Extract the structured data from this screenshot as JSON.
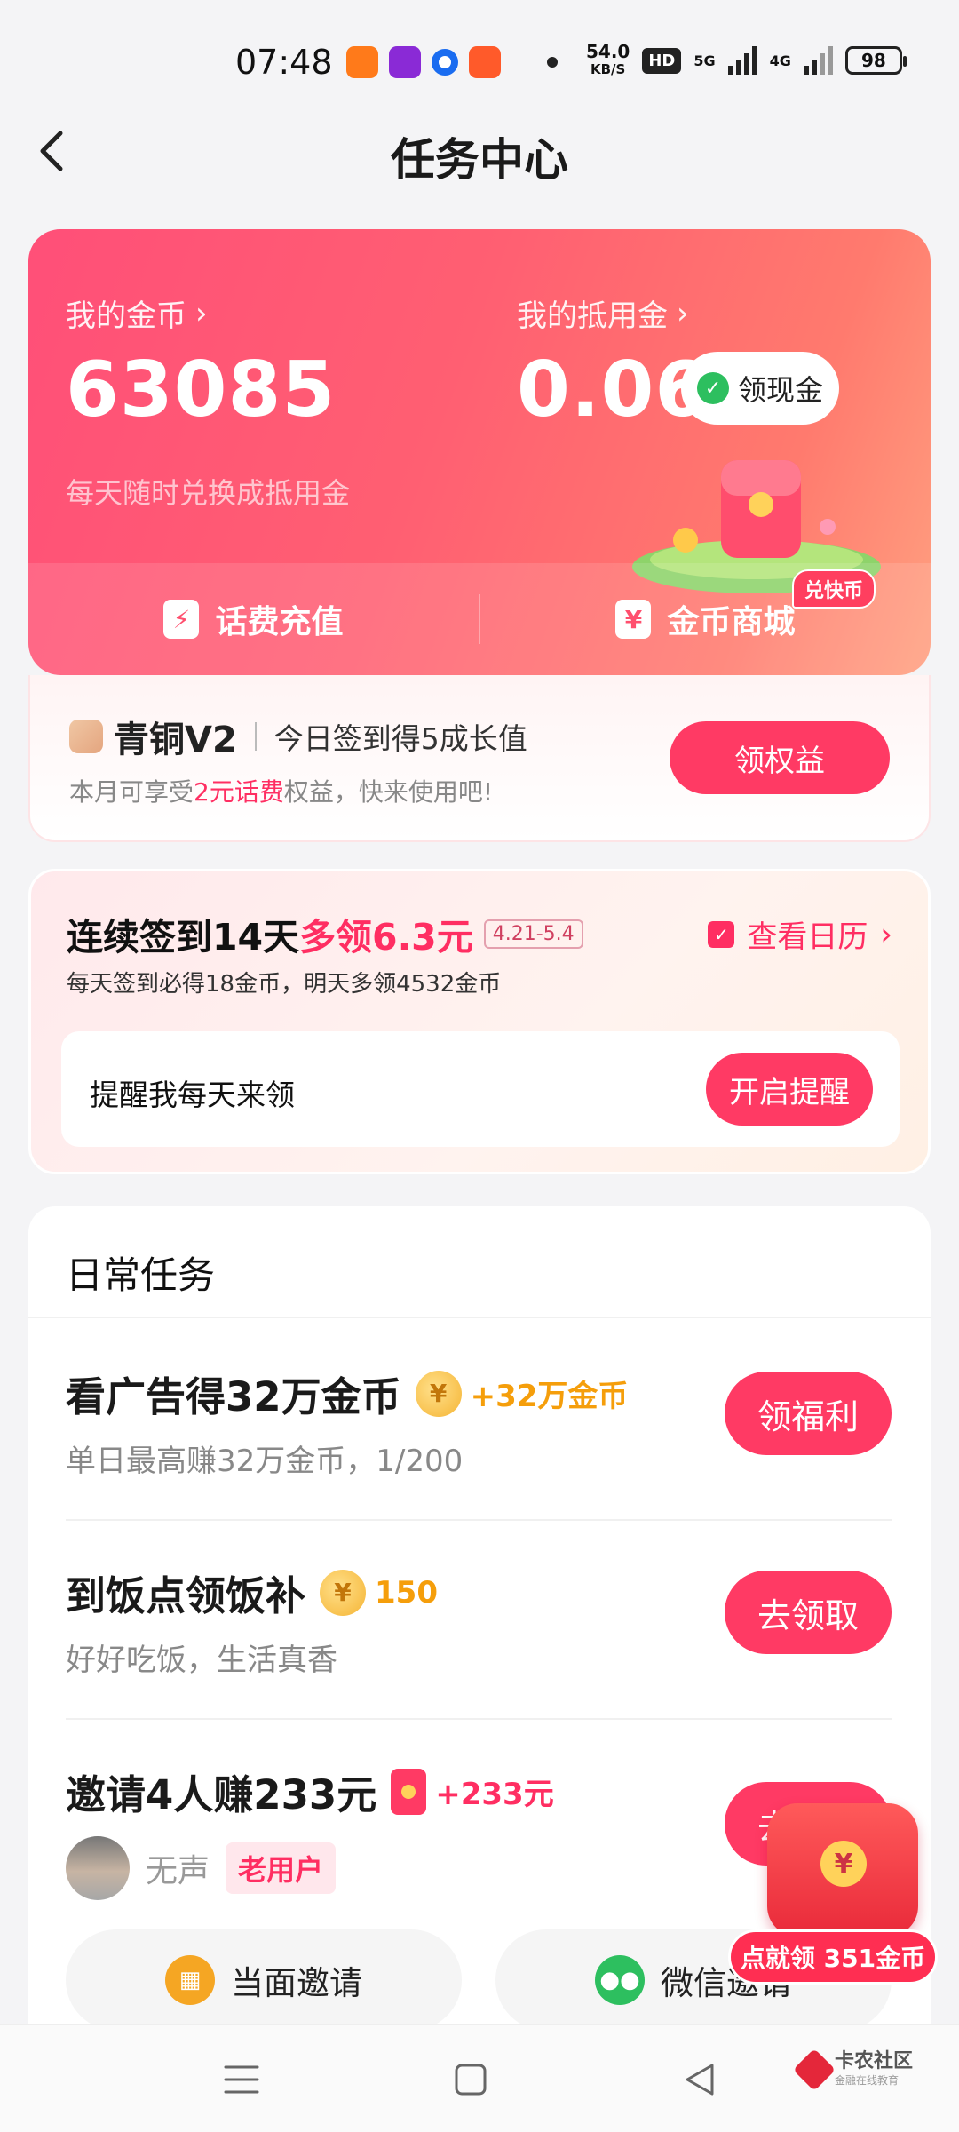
{
  "status_bar": {
    "time": "07:48",
    "net_speed_value": "54.0",
    "net_speed_unit": "KB/S",
    "hd_label": "HD",
    "net_5g": "5G",
    "net_4g": "4G",
    "battery": "98"
  },
  "header": {
    "title": "任务中心"
  },
  "hero": {
    "coins_label": "我的金币",
    "coins_value": "63085",
    "coins_sub": "每天随时兑换成抵用金",
    "voucher_label": "我的抵用金",
    "voucher_value": "0.06",
    "cash_button": "领现金",
    "recharge_label": "话费充值",
    "mall_label": "金币商城",
    "mall_badge": "兑快币"
  },
  "level": {
    "name": "青铜V2",
    "tip": "今日签到得5成长值",
    "desc_prefix": "本月可享受",
    "desc_highlight": "2元话费",
    "desc_suffix": "权益，快来使用吧!",
    "button": "领权益"
  },
  "checkin": {
    "title_prefix": "连续签到14天",
    "title_highlight": "多领6.3元",
    "date_range": "4.21-5.4",
    "calendar_link": "查看日历",
    "subtitle": "每天签到必得18金币，明天多领4532金币",
    "remind_label": "提醒我每天来领",
    "remind_button": "开启提醒"
  },
  "daily_tasks": {
    "title": "日常任务",
    "tasks": [
      {
        "name": "看广告得32万金币",
        "reward": "+32万金币",
        "desc": "单日最高赚32万金币，1/200",
        "button": "领福利"
      },
      {
        "name": "到饭点领饭补",
        "reward": "150",
        "desc": "好好吃饭，生活真香",
        "button": "去领取"
      },
      {
        "name": "邀请4人赚233元",
        "reward": "+233元",
        "user_name": "无声",
        "user_tag": "老用户",
        "button": "去邀请"
      }
    ],
    "invite_face": "当面邀请",
    "invite_wechat": "微信邀请"
  },
  "float_pack": {
    "label": "点就领 351金币"
  },
  "watermark": {
    "name": "卡农社区",
    "sub": "金融在线教育"
  },
  "colors": {
    "accent": "#ff3a64",
    "coin": "#f59e0b"
  }
}
